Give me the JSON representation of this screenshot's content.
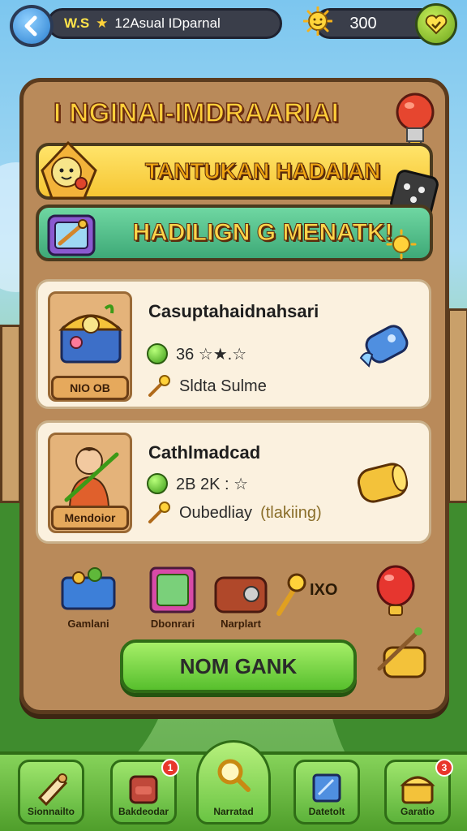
{
  "topbar": {
    "level": "W.S",
    "title": "12Asual IDparnal",
    "coins": "300"
  },
  "header": {
    "title": "I NGINAI-IMDRAARIAI"
  },
  "banners": [
    {
      "label": "TANTUKAN HADAIAN"
    },
    {
      "label": "HADILIGN G MENATK!"
    }
  ],
  "cards": [
    {
      "title": "Casuptahaidnahsari",
      "tag": "NIO OB",
      "stat": "36 ☆★.☆",
      "detail": "Sldta Sulme"
    },
    {
      "title": "Cathlmadcad",
      "tag": "Mendoior",
      "stat": "2B 2K : ☆",
      "detail": "Oubedliay",
      "detail_extra": "(tlakiing)"
    }
  ],
  "items": [
    {
      "label": "Gamlani"
    },
    {
      "label": "Dbonrari"
    },
    {
      "label": "Narplart"
    },
    {
      "label": "IXO"
    }
  ],
  "main_button": {
    "label": "NOM GANK"
  },
  "bottom_nav": [
    {
      "label": "Sionnailto",
      "badge": ""
    },
    {
      "label": "Bakdeodar",
      "badge": "1"
    },
    {
      "label": "Narratad",
      "badge": ""
    },
    {
      "label": "Datetolt",
      "badge": ""
    },
    {
      "label": "Garatio",
      "badge": "3"
    }
  ],
  "colors": {
    "panel": "#b98a5a",
    "accent_green": "#57bf2d",
    "accent_yellow": "#f6c633",
    "title": "#ffcf3a"
  }
}
